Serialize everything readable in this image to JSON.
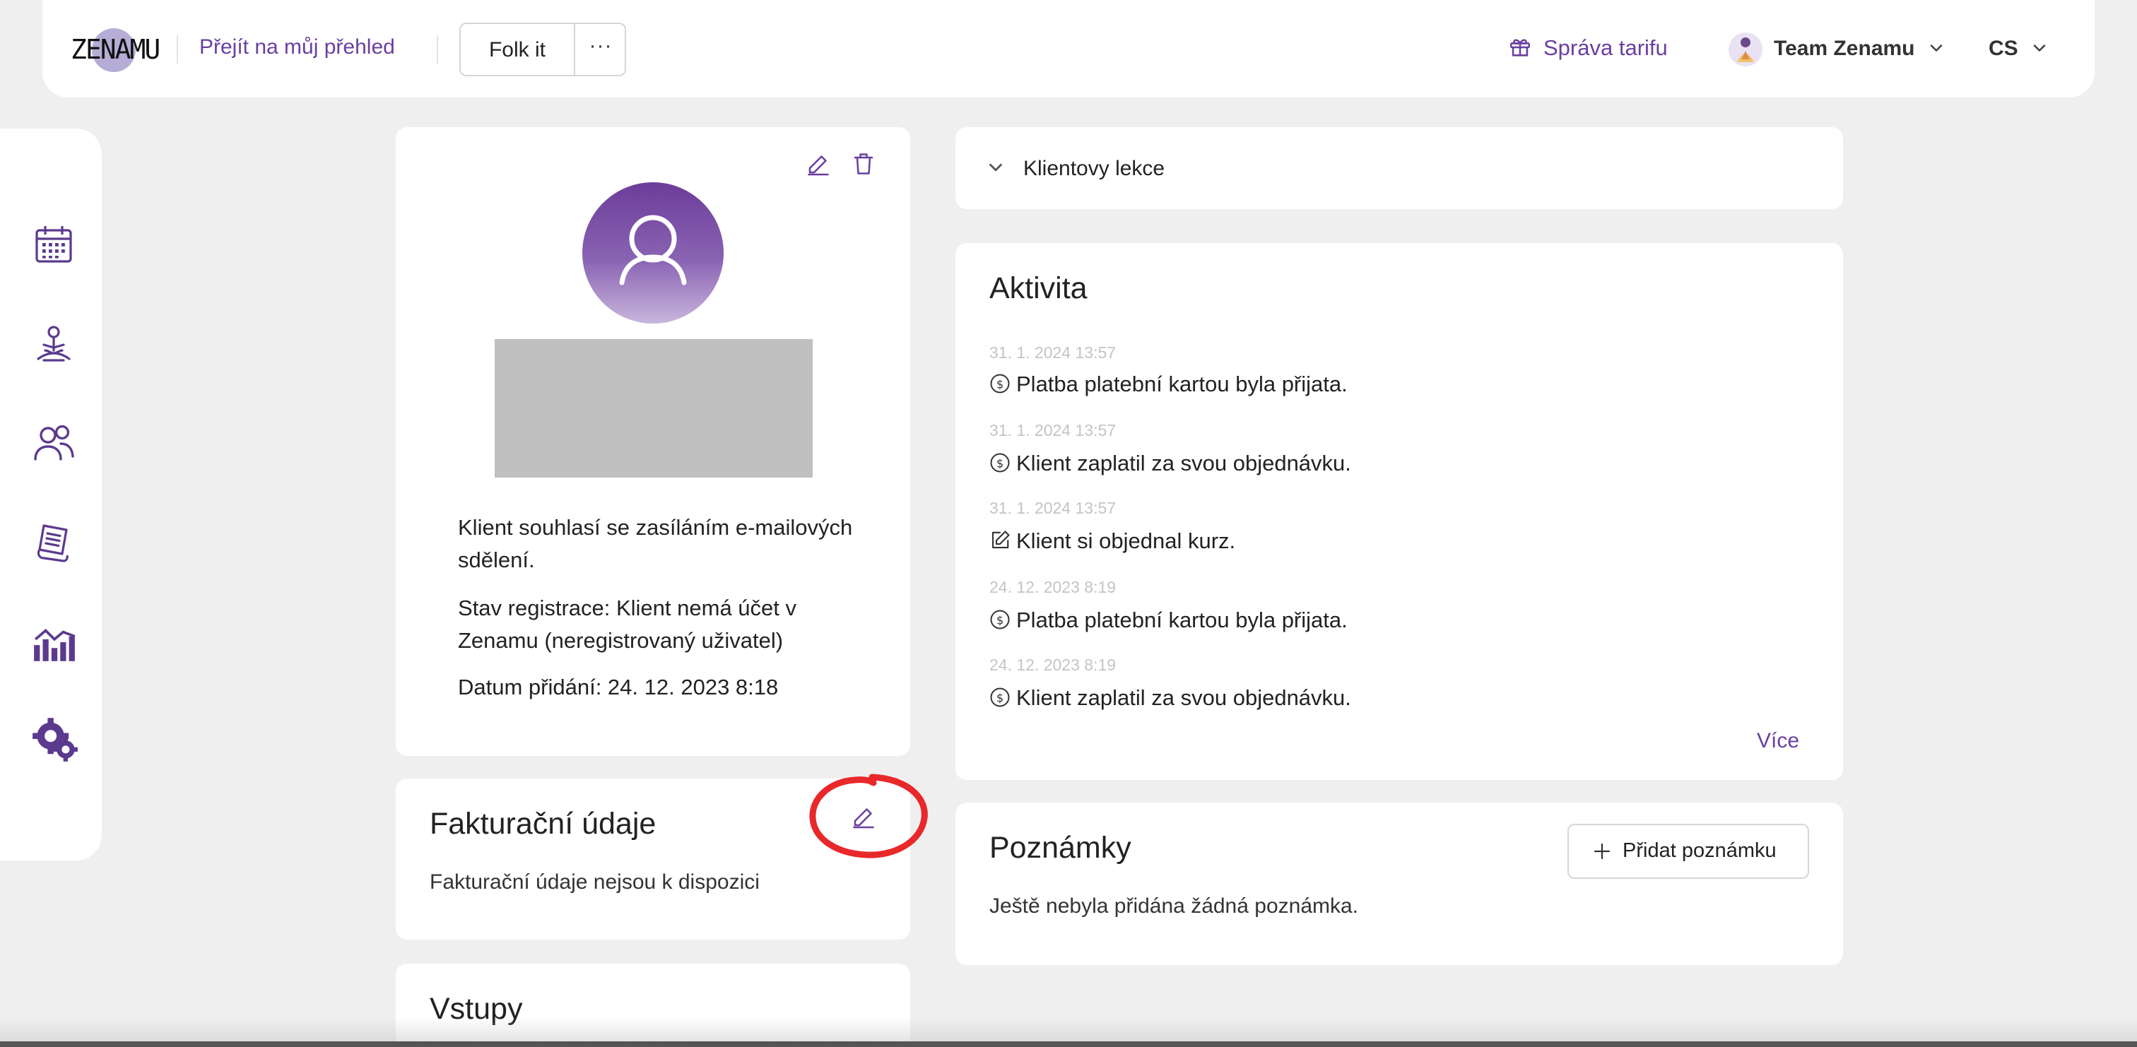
{
  "header": {
    "logo_text": "ZENAMU",
    "overview_link": "Přejít na můj přehled",
    "client_button": "Folk it",
    "more_button": "···",
    "plan_link": "Správa tarifu",
    "team_name": "Team Zenamu",
    "language": "CS"
  },
  "sidebar": {
    "items": [
      {
        "icon": "calendar-icon"
      },
      {
        "icon": "meditation-icon"
      },
      {
        "icon": "users-icon"
      },
      {
        "icon": "receipt-icon"
      },
      {
        "icon": "stats-icon"
      },
      {
        "icon": "settings-icon"
      }
    ]
  },
  "profile": {
    "consent_text": "Klient souhlasí se zasíláním e-mailových sdělení.",
    "registration_text": "Stav registrace: Klient nemá účet v Zenamu (neregistrovaný uživatel)",
    "date_added_text": "Datum přidání: 24. 12. 2023 8:18"
  },
  "billing": {
    "title": "Fakturační údaje",
    "empty_text": "Fakturační údaje nejsou k dispozici"
  },
  "entries": {
    "title": "Vstupy"
  },
  "lessons": {
    "label": "Klientovy lekce"
  },
  "activity": {
    "title": "Aktivita",
    "items": [
      {
        "time": "31. 1. 2024 13:57",
        "text": "Platba platební kartou byla přijata.",
        "icon": "dollar-icon"
      },
      {
        "time": "31. 1. 2024 13:57",
        "text": "Klient zaplatil za svou objednávku.",
        "icon": "dollar-icon"
      },
      {
        "time": "31. 1. 2024 13:57",
        "text": "Klient si objednal kurz.",
        "icon": "edit-square-icon"
      },
      {
        "time": "24. 12. 2023 8:19",
        "text": "Platba platební kartou byla přijata.",
        "icon": "dollar-icon"
      },
      {
        "time": "24. 12. 2023 8:19",
        "text": "Klient zaplatil za svou objednávku.",
        "icon": "dollar-icon"
      }
    ],
    "more_link": "Více"
  },
  "notes": {
    "title": "Poznámky",
    "add_button": "Přidat poznámku",
    "empty_text": "Ještě nebyla přidána žádná poznámka."
  },
  "colors": {
    "accent": "#6a3fa0",
    "highlight_circle": "#e8282a",
    "background": "#efefef"
  }
}
